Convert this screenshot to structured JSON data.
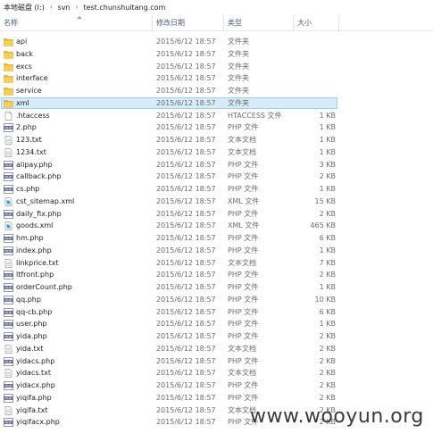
{
  "breadcrumb": {
    "items": [
      "本地磁盘 (I:)",
      "svn",
      "test.chunshuitang.com"
    ],
    "separator": "›"
  },
  "columns": {
    "name": "名称",
    "date": "修改日期",
    "type": "类型",
    "size": "大小"
  },
  "files": [
    {
      "name": "api",
      "date": "2015/6/12 18:57",
      "type": "文件夹",
      "size": "",
      "icon": "folder-icon"
    },
    {
      "name": "back",
      "date": "2015/6/12 18:57",
      "type": "文件夹",
      "size": "",
      "icon": "folder-icon"
    },
    {
      "name": "excs",
      "date": "2015/6/12 18:57",
      "type": "文件夹",
      "size": "",
      "icon": "folder-icon"
    },
    {
      "name": "interface",
      "date": "2015/6/12 18:57",
      "type": "文件夹",
      "size": "",
      "icon": "folder-icon"
    },
    {
      "name": "service",
      "date": "2015/6/12 18:57",
      "type": "文件夹",
      "size": "",
      "icon": "folder-icon"
    },
    {
      "name": "xml",
      "date": "2015/6/12 18:57",
      "type": "文件夹",
      "size": "",
      "icon": "folder-icon",
      "selected": true
    },
    {
      "name": ".htaccess",
      "date": "2015/6/12 18:57",
      "type": "HTACCESS 文件",
      "size": "1 KB",
      "icon": "blank-file-icon"
    },
    {
      "name": "2.php",
      "date": "2015/6/12 18:57",
      "type": "PHP 文件",
      "size": "1 KB",
      "icon": "php-file-icon"
    },
    {
      "name": "123.txt",
      "date": "2015/6/12 18:57",
      "type": "文本文档",
      "size": "1 KB",
      "icon": "text-file-icon"
    },
    {
      "name": "1234.txt",
      "date": "2015/6/12 18:57",
      "type": "文本文档",
      "size": "1 KB",
      "icon": "text-file-icon"
    },
    {
      "name": "alipay.php",
      "date": "2015/6/12 18:57",
      "type": "PHP 文件",
      "size": "3 KB",
      "icon": "php-file-icon"
    },
    {
      "name": "callback.php",
      "date": "2015/6/12 18:57",
      "type": "PHP 文件",
      "size": "2 KB",
      "icon": "php-file-icon"
    },
    {
      "name": "cs.php",
      "date": "2015/6/12 18:57",
      "type": "PHP 文件",
      "size": "1 KB",
      "icon": "php-file-icon"
    },
    {
      "name": "cst_sitemap.xml",
      "date": "2015/6/12 18:57",
      "type": "XML 文件",
      "size": "15 KB",
      "icon": "xml-file-icon"
    },
    {
      "name": "daily_fix.php",
      "date": "2015/6/12 18:57",
      "type": "PHP 文件",
      "size": "2 KB",
      "icon": "php-file-icon"
    },
    {
      "name": "goods.xml",
      "date": "2015/6/12 18:57",
      "type": "XML 文件",
      "size": "465 KB",
      "icon": "xml-file-icon"
    },
    {
      "name": "hm.php",
      "date": "2015/6/12 18:57",
      "type": "PHP 文件",
      "size": "6 KB",
      "icon": "php-file-icon"
    },
    {
      "name": "index.php",
      "date": "2015/6/12 18:57",
      "type": "PHP 文件",
      "size": "1 KB",
      "icon": "php-file-icon"
    },
    {
      "name": "linkprice.txt",
      "date": "2015/6/12 18:57",
      "type": "文本文档",
      "size": "7 KB",
      "icon": "text-file-icon"
    },
    {
      "name": "ltfront.php",
      "date": "2015/6/12 18:57",
      "type": "PHP 文件",
      "size": "2 KB",
      "icon": "php-file-icon"
    },
    {
      "name": "orderCount.php",
      "date": "2015/6/12 18:57",
      "type": "PHP 文件",
      "size": "1 KB",
      "icon": "php-file-icon"
    },
    {
      "name": "qq.php",
      "date": "2015/6/12 18:57",
      "type": "PHP 文件",
      "size": "10 KB",
      "icon": "php-file-icon"
    },
    {
      "name": "qq-cb.php",
      "date": "2015/6/12 18:57",
      "type": "PHP 文件",
      "size": "6 KB",
      "icon": "php-file-icon"
    },
    {
      "name": "user.php",
      "date": "2015/6/12 18:57",
      "type": "PHP 文件",
      "size": "1 KB",
      "icon": "php-file-icon"
    },
    {
      "name": "yida.php",
      "date": "2015/6/12 18:57",
      "type": "PHP 文件",
      "size": "2 KB",
      "icon": "php-file-icon"
    },
    {
      "name": "yida.txt",
      "date": "2015/6/12 18:57",
      "type": "文本文档",
      "size": "2 KB",
      "icon": "text-file-icon"
    },
    {
      "name": "yidacs.php",
      "date": "2015/6/12 18:57",
      "type": "PHP 文件",
      "size": "2 KB",
      "icon": "php-file-icon"
    },
    {
      "name": "yidacs.txt",
      "date": "2015/6/12 18:57",
      "type": "文本文档",
      "size": "2 KB",
      "icon": "text-file-icon"
    },
    {
      "name": "yidacx.php",
      "date": "2015/6/12 18:57",
      "type": "PHP 文件",
      "size": "2 KB",
      "icon": "php-file-icon"
    },
    {
      "name": "yiqifa.php",
      "date": "2015/6/12 18:57",
      "type": "PHP 文件",
      "size": "2 KB",
      "icon": "php-file-icon"
    },
    {
      "name": "yiqifa.txt",
      "date": "2015/6/12 18:57",
      "type": "文本文档",
      "size": "2 KB",
      "icon": "text-file-icon"
    },
    {
      "name": "yiqifacx.php",
      "date": "2015/6/12 18:57",
      "type": "PHP 文件",
      "size": "2 KB",
      "icon": "php-file-icon"
    }
  ],
  "watermark": "www.wooyun.org",
  "colors": {
    "selection_bg": "#d9ebf9",
    "selection_border": "#99d1ff",
    "folder": "#e8b73a",
    "header_text": "#4c607a"
  }
}
